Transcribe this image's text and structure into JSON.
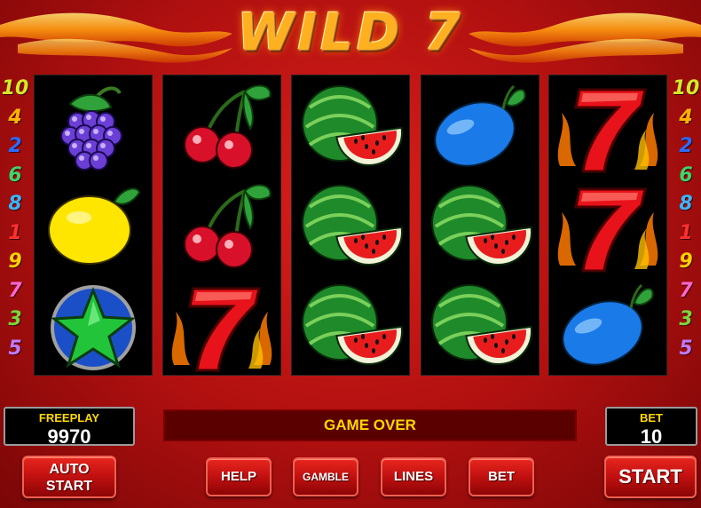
{
  "title": "WILD 7",
  "paylines": {
    "left": [
      "10",
      "4",
      "2",
      "6",
      "8",
      "1",
      "9",
      "7",
      "3",
      "5"
    ],
    "right": [
      "10",
      "4",
      "2",
      "6",
      "8",
      "1",
      "9",
      "7",
      "3",
      "5"
    ],
    "colors": {
      "10": "#d4e82a",
      "4": "#ffb300",
      "2": "#2a6cff",
      "6": "#3fd46a",
      "8": "#38b6ff",
      "1": "#ff3030",
      "9": "#ffd000",
      "7": "#ff66d0",
      "3": "#7ad63a",
      "5": "#c07aff"
    }
  },
  "reels": [
    [
      "grapes-icon",
      "lemon-icon",
      "star-icon"
    ],
    [
      "cherries-icon",
      "cherries-icon",
      "seven-icon"
    ],
    [
      "watermelon-icon",
      "watermelon-icon",
      "watermelon-icon"
    ],
    [
      "plum-icon",
      "watermelon-icon",
      "watermelon-icon"
    ],
    [
      "seven-icon",
      "seven-icon",
      "plum-icon"
    ]
  ],
  "freeplay": {
    "label": "FREEPLAY",
    "value": "9970"
  },
  "bet": {
    "label": "BET",
    "value": "10"
  },
  "status": "GAME OVER",
  "buttons": {
    "auto_start": [
      "AUTO",
      "START"
    ],
    "help": "HELP",
    "gamble": "GAMBLE",
    "lines": "LINES",
    "bet": "BET",
    "start": "START"
  },
  "colors": {
    "accent": "#ffd800",
    "background": "#c01414",
    "reel_bg": "#000000"
  }
}
